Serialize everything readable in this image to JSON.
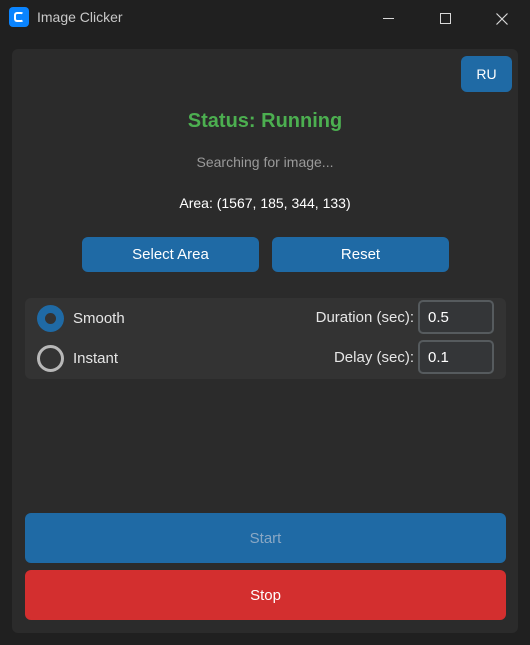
{
  "window": {
    "title": "Image Clicker"
  },
  "header": {
    "language_button": "RU"
  },
  "status": {
    "title": "Status: Running",
    "message": "Searching for image...",
    "area": "Area: (1567, 185, 344, 133)"
  },
  "area_buttons": {
    "select": "Select Area",
    "reset": "Reset"
  },
  "options": {
    "mode_smooth": "Smooth",
    "mode_instant": "Instant",
    "selected_mode": "Smooth",
    "duration_label": "Duration (sec):",
    "duration_value": "0.5",
    "delay_label": "Delay (sec):",
    "delay_value": "0.1"
  },
  "actions": {
    "start": "Start",
    "stop": "Stop"
  },
  "colors": {
    "accent": "#1f6aa5",
    "status_running": "#4caf50",
    "stop": "#d32f2f",
    "background": "#2b2b2b"
  }
}
